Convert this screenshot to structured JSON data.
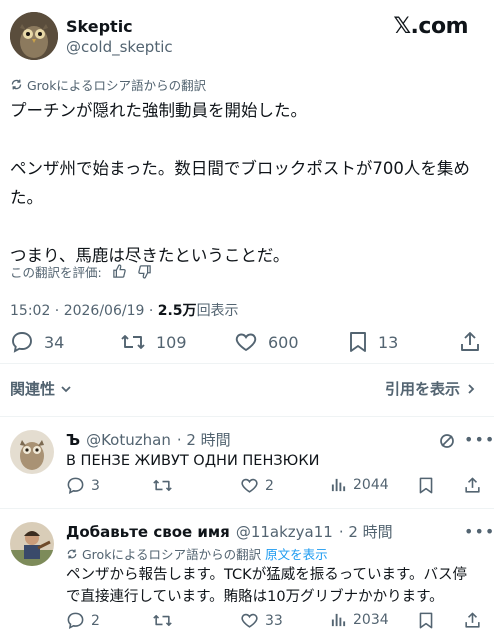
{
  "author": {
    "display_name": "Skeptic",
    "handle": "@cold_skeptic"
  },
  "brand": "𝕏.com",
  "post": {
    "translated_label": "Grokによるロシア語からの翻訳",
    "lines": [
      "プーチンが隠れた強制動員を開始した。",
      "",
      "ペンザ州で始まった。数日間でブロックポストが700人を集め",
      "た。",
      "",
      "つまり、馬鹿は尽きたということだ。"
    ],
    "rate_label": "この翻訳を評価:",
    "time_date": "15:02 · 2026/06/19 · ",
    "views_count": "2.5万",
    "views_label": "回表示"
  },
  "stats": {
    "replies": "34",
    "reposts": "109",
    "likes": "600",
    "bookmarks": "13"
  },
  "related_label": "関連性",
  "quotes_label": "引用を表示",
  "replies": [
    {
      "name": "Ъ",
      "handle": "@Kotuzhan",
      "time": "· 2 時間",
      "text": "В ПЕНЗЕ ЖИВУТ ОДНИ ПЕНЗЮКИ",
      "replies": "3",
      "reposts": "",
      "likes": "2",
      "views": "2044"
    },
    {
      "name": "Добавьте свое имя",
      "handle": "@11akzya11",
      "time": "· 2 時間",
      "translated_label": "Grokによるロシア語からの翻訳",
      "show_original": "原文を表示",
      "text_line1": "ペンザから報告します。TCKが猛威を振るっています。バス停",
      "text_line2": "で直接連行しています。賄賂は10万グリブナかかります。",
      "replies": "2",
      "reposts": "",
      "likes": "33",
      "views": "2034"
    }
  ]
}
